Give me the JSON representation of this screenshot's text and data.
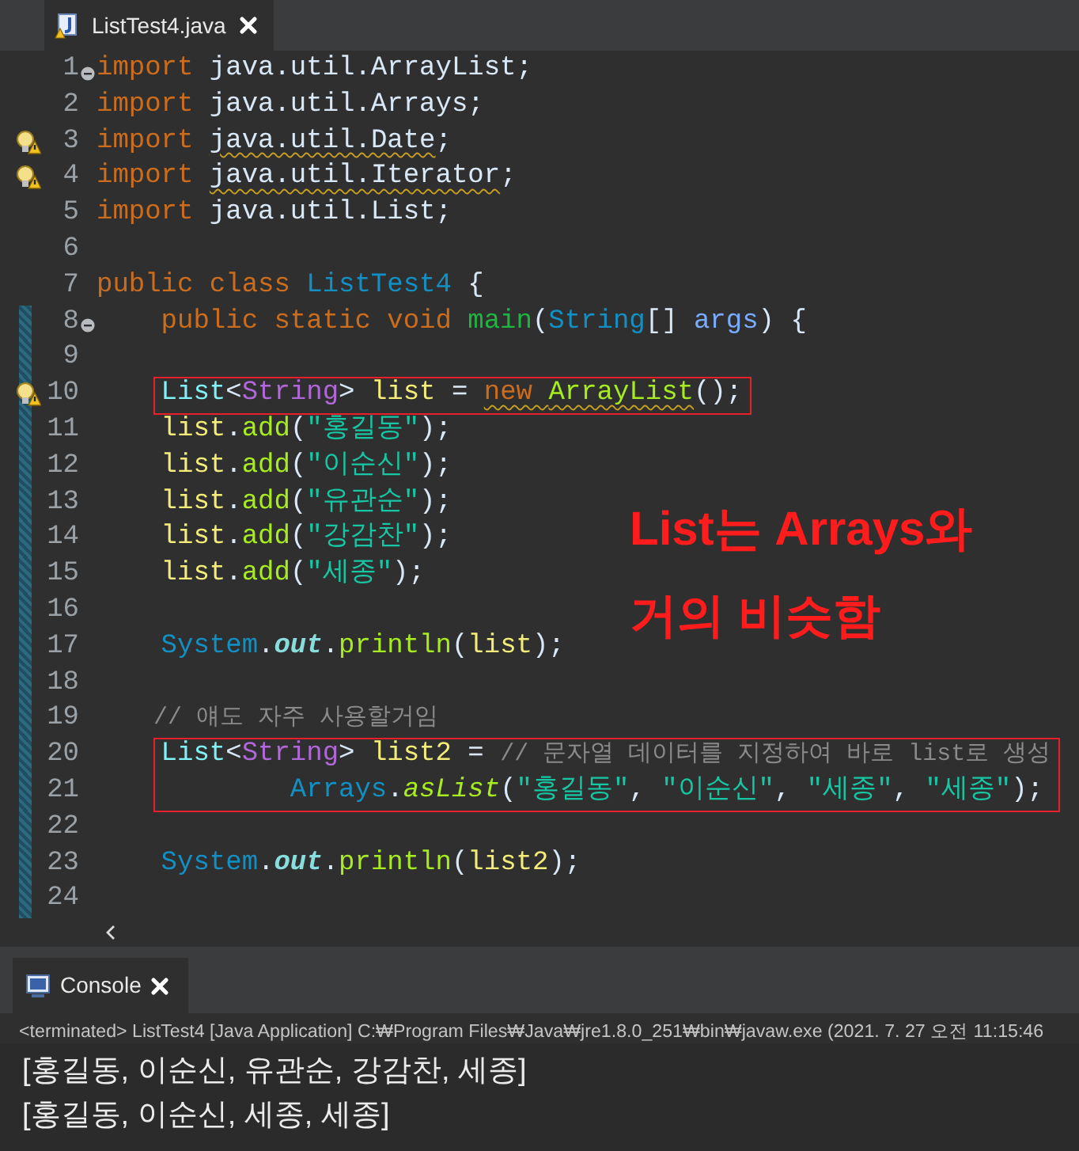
{
  "editor_tab": {
    "title": "ListTest4.java",
    "selected": true
  },
  "lines": [
    {
      "number": "1",
      "foldable": true,
      "has_warning": false,
      "changed": false,
      "boxed": false,
      "tokens": [
        {
          "text": "import",
          "kind": "keyword",
          "warning": false
        },
        {
          "text": " java.util.ArrayList;",
          "kind": "plain",
          "warning": false
        }
      ]
    },
    {
      "number": "2",
      "foldable": false,
      "has_warning": false,
      "changed": false,
      "boxed": false,
      "tokens": [
        {
          "text": "import",
          "kind": "keyword",
          "warning": false
        },
        {
          "text": " java.util.Arrays;",
          "kind": "plain",
          "warning": false
        }
      ]
    },
    {
      "number": "3",
      "foldable": false,
      "has_warning": true,
      "changed": false,
      "boxed": false,
      "tokens": [
        {
          "text": "import ",
          "kind": "keyword",
          "warning": false
        },
        {
          "text": "java.util.Date",
          "kind": "plain",
          "warning": true
        },
        {
          "text": ";",
          "kind": "plain",
          "warning": false
        }
      ]
    },
    {
      "number": "4",
      "foldable": false,
      "has_warning": true,
      "changed": false,
      "boxed": false,
      "tokens": [
        {
          "text": "import ",
          "kind": "keyword",
          "warning": false
        },
        {
          "text": "java.util.Iterator",
          "kind": "plain",
          "warning": true
        },
        {
          "text": ";",
          "kind": "plain",
          "warning": false
        }
      ]
    },
    {
      "number": "5",
      "foldable": false,
      "has_warning": false,
      "changed": false,
      "boxed": false,
      "tokens": [
        {
          "text": "import",
          "kind": "keyword",
          "warning": false
        },
        {
          "text": " java.util.List;",
          "kind": "plain",
          "warning": false
        }
      ]
    },
    {
      "number": "6",
      "foldable": false,
      "has_warning": false,
      "changed": false,
      "boxed": false
    },
    {
      "number": "7",
      "foldable": false,
      "has_warning": false,
      "changed": false,
      "boxed": false,
      "tokens": [
        {
          "text": "public class ",
          "kind": "keyword",
          "warning": false
        },
        {
          "text": "ListTest4",
          "kind": "class",
          "warning": false
        },
        {
          "text": " {",
          "kind": "plain",
          "warning": false
        }
      ]
    },
    {
      "number": "8",
      "foldable": true,
      "has_warning": false,
      "changed": true,
      "boxed": false,
      "tokens": [
        {
          "text": "    public static void ",
          "kind": "keyword",
          "warning": false
        },
        {
          "text": "main",
          "kind": "method-decl",
          "warning": false
        },
        {
          "text": "(",
          "kind": "plain",
          "warning": false
        },
        {
          "text": "String",
          "kind": "class",
          "warning": false
        },
        {
          "text": "[] ",
          "kind": "plain",
          "warning": false
        },
        {
          "text": "args",
          "kind": "param",
          "warning": false
        },
        {
          "text": ") {",
          "kind": "plain",
          "warning": false
        }
      ]
    },
    {
      "number": "9",
      "foldable": false,
      "has_warning": false,
      "changed": true,
      "boxed": false
    },
    {
      "number": "10",
      "foldable": false,
      "has_warning": true,
      "changed": true,
      "boxed": true,
      "tokens": [
        {
          "text": "    List",
          "kind": "interface",
          "warning": false
        },
        {
          "text": "<",
          "kind": "plain",
          "warning": false
        },
        {
          "text": "String",
          "kind": "type-arg",
          "warning": false
        },
        {
          "text": "> ",
          "kind": "plain",
          "warning": false
        },
        {
          "text": "list",
          "kind": "variable",
          "warning": false
        },
        {
          "text": " = ",
          "kind": "plain",
          "warning": false
        },
        {
          "text": "new ",
          "kind": "keyword",
          "warning": true
        },
        {
          "text": "ArrayList",
          "kind": "method",
          "warning": true
        },
        {
          "text": "();",
          "kind": "plain",
          "warning": false
        }
      ]
    },
    {
      "number": "11",
      "foldable": false,
      "has_warning": false,
      "changed": true,
      "boxed": false,
      "tokens": [
        {
          "text": "    list",
          "kind": "variable",
          "warning": false
        },
        {
          "text": ".",
          "kind": "plain",
          "warning": false
        },
        {
          "text": "add",
          "kind": "method",
          "warning": false
        },
        {
          "text": "(",
          "kind": "plain",
          "warning": false
        },
        {
          "text": "\"홍길동\"",
          "kind": "string",
          "warning": false
        },
        {
          "text": ");",
          "kind": "plain",
          "warning": false
        }
      ]
    },
    {
      "number": "12",
      "foldable": false,
      "has_warning": false,
      "changed": true,
      "boxed": false,
      "tokens": [
        {
          "text": "    list",
          "kind": "variable",
          "warning": false
        },
        {
          "text": ".",
          "kind": "plain",
          "warning": false
        },
        {
          "text": "add",
          "kind": "method",
          "warning": false
        },
        {
          "text": "(",
          "kind": "plain",
          "warning": false
        },
        {
          "text": "\"이순신\"",
          "kind": "string",
          "warning": false
        },
        {
          "text": ");",
          "kind": "plain",
          "warning": false
        }
      ]
    },
    {
      "number": "13",
      "foldable": false,
      "has_warning": false,
      "changed": true,
      "boxed": false,
      "tokens": [
        {
          "text": "    list",
          "kind": "variable",
          "warning": false
        },
        {
          "text": ".",
          "kind": "plain",
          "warning": false
        },
        {
          "text": "add",
          "kind": "method",
          "warning": false
        },
        {
          "text": "(",
          "kind": "plain",
          "warning": false
        },
        {
          "text": "\"유관순\"",
          "kind": "string",
          "warning": false
        },
        {
          "text": ");",
          "kind": "plain",
          "warning": false
        }
      ]
    },
    {
      "number": "14",
      "foldable": false,
      "has_warning": false,
      "changed": true,
      "boxed": false,
      "tokens": [
        {
          "text": "    list",
          "kind": "variable",
          "warning": false
        },
        {
          "text": ".",
          "kind": "plain",
          "warning": false
        },
        {
          "text": "add",
          "kind": "method",
          "warning": false
        },
        {
          "text": "(",
          "kind": "plain",
          "warning": false
        },
        {
          "text": "\"강감찬\"",
          "kind": "string",
          "warning": false
        },
        {
          "text": ");",
          "kind": "plain",
          "warning": false
        }
      ]
    },
    {
      "number": "15",
      "foldable": false,
      "has_warning": false,
      "changed": true,
      "boxed": false,
      "tokens": [
        {
          "text": "    list",
          "kind": "variable",
          "warning": false
        },
        {
          "text": ".",
          "kind": "plain",
          "warning": false
        },
        {
          "text": "add",
          "kind": "method",
          "warning": false
        },
        {
          "text": "(",
          "kind": "plain",
          "warning": false
        },
        {
          "text": "\"세종\"",
          "kind": "string",
          "warning": false
        },
        {
          "text": ");",
          "kind": "plain",
          "warning": false
        }
      ]
    },
    {
      "number": "16",
      "foldable": false,
      "has_warning": false,
      "changed": true,
      "boxed": false
    },
    {
      "number": "17",
      "foldable": false,
      "has_warning": false,
      "changed": true,
      "boxed": false,
      "tokens": [
        {
          "text": "    System",
          "kind": "class",
          "warning": false
        },
        {
          "text": ".",
          "kind": "plain",
          "warning": false
        },
        {
          "text": "out",
          "kind": "static-field",
          "warning": false
        },
        {
          "text": ".",
          "kind": "plain",
          "warning": false
        },
        {
          "text": "println",
          "kind": "method",
          "warning": false
        },
        {
          "text": "(",
          "kind": "plain",
          "warning": false
        },
        {
          "text": "list",
          "kind": "variable",
          "warning": false
        },
        {
          "text": ");",
          "kind": "plain",
          "warning": false
        }
      ]
    },
    {
      "number": "18",
      "foldable": false,
      "has_warning": false,
      "changed": true,
      "boxed": false
    },
    {
      "number": "19",
      "foldable": false,
      "has_warning": false,
      "changed": true,
      "boxed": false,
      "tokens": [
        {
          "text": "    // 얘도 자주 사용할거임",
          "kind": "comment",
          "warning": false
        }
      ]
    },
    {
      "number": "20",
      "foldable": false,
      "has_warning": false,
      "changed": true,
      "boxed": true,
      "tokens": [
        {
          "text": "    List",
          "kind": "interface",
          "warning": false
        },
        {
          "text": "<",
          "kind": "plain",
          "warning": false
        },
        {
          "text": "String",
          "kind": "type-arg",
          "warning": false
        },
        {
          "text": "> ",
          "kind": "plain",
          "warning": false
        },
        {
          "text": "list2",
          "kind": "variable",
          "warning": false
        },
        {
          "text": " = ",
          "kind": "plain",
          "warning": false
        },
        {
          "text": "// 문자열 데이터를 지정하여 바로 list로 생성",
          "kind": "comment",
          "warning": false
        }
      ]
    },
    {
      "number": "21",
      "foldable": false,
      "has_warning": false,
      "changed": true,
      "boxed": true,
      "tokens": [
        {
          "text": "            Arrays",
          "kind": "class",
          "warning": false
        },
        {
          "text": ".",
          "kind": "plain",
          "warning": false
        },
        {
          "text": "asList",
          "kind": "static-method",
          "warning": false
        },
        {
          "text": "(",
          "kind": "plain",
          "warning": false
        },
        {
          "text": "\"홍길동\"",
          "kind": "string",
          "warning": false
        },
        {
          "text": ", ",
          "kind": "plain",
          "warning": false
        },
        {
          "text": "\"이순신\"",
          "kind": "string",
          "warning": false
        },
        {
          "text": ", ",
          "kind": "plain",
          "warning": false
        },
        {
          "text": "\"세종\"",
          "kind": "string",
          "warning": false
        },
        {
          "text": ", ",
          "kind": "plain",
          "warning": false
        },
        {
          "text": "\"세종\"",
          "kind": "string",
          "warning": false
        },
        {
          "text": ");",
          "kind": "plain",
          "warning": false
        }
      ]
    },
    {
      "number": "22",
      "foldable": false,
      "has_warning": false,
      "changed": true,
      "boxed": false
    },
    {
      "number": "23",
      "foldable": false,
      "has_warning": false,
      "changed": true,
      "boxed": false,
      "tokens": [
        {
          "text": "    System",
          "kind": "class",
          "warning": false
        },
        {
          "text": ".",
          "kind": "plain",
          "warning": false
        },
        {
          "text": "out",
          "kind": "static-field",
          "warning": false
        },
        {
          "text": ".",
          "kind": "plain",
          "warning": false
        },
        {
          "text": "println",
          "kind": "method",
          "warning": false
        },
        {
          "text": "(",
          "kind": "plain",
          "warning": false
        },
        {
          "text": "list2",
          "kind": "variable",
          "warning": false
        },
        {
          "text": ");",
          "kind": "plain",
          "warning": false
        }
      ]
    },
    {
      "number": "24",
      "foldable": false,
      "has_warning": false,
      "changed": true,
      "boxed": false
    }
  ],
  "annotation": [
    "List는 Arrays와",
    "거의 비슷함"
  ],
  "console": {
    "tab": {
      "title": "Console",
      "selected": true
    },
    "status": "<terminated> ListTest4 [Java Application] C:₩Program Files₩Java₩jre1.8.0_251₩bin₩javaw.exe  (2021. 7. 27 오전 11:15:46",
    "output": [
      "[홍길동, 이순신, 유관순, 강감찬, 세종]",
      "[홍길동, 이순신, 세종, 세종]"
    ]
  }
}
